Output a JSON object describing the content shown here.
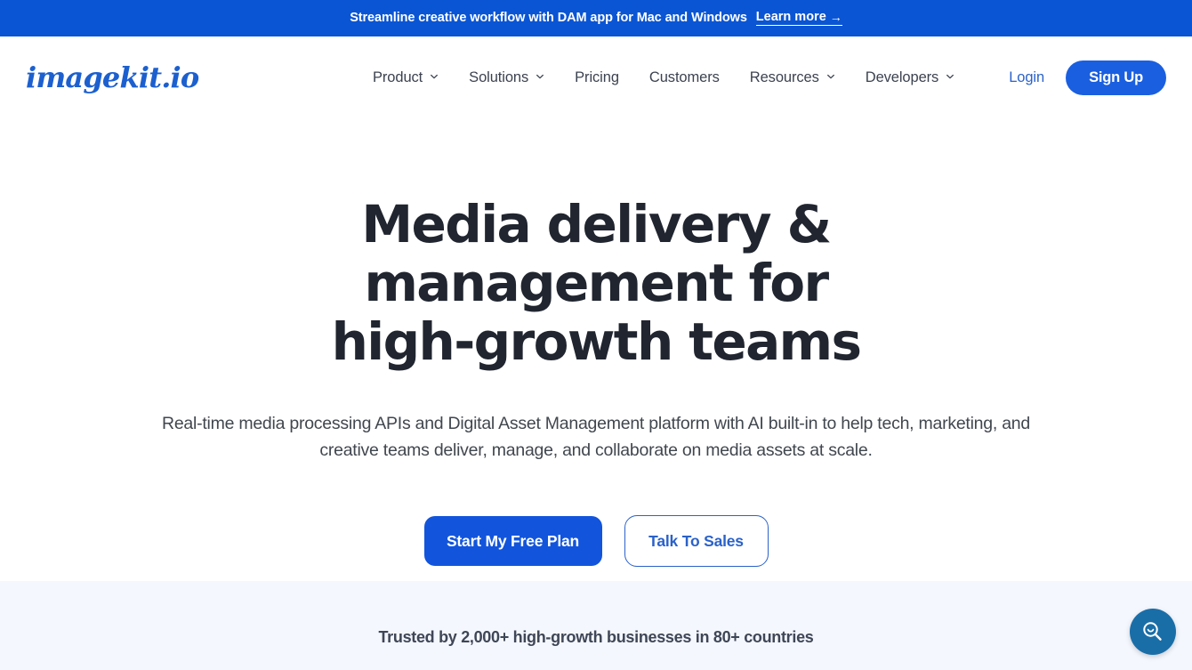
{
  "announcement": {
    "text": "Streamline creative workflow with DAM app for Mac and Windows",
    "link_label": "Learn more",
    "link_arrow": "→",
    "background_color": "#0a55d4"
  },
  "header": {
    "logo_text": "imagekit.io",
    "logo_color": "#1c60cf",
    "nav": [
      {
        "label": "Product",
        "has_caret": true,
        "icon": "chevron-down-icon"
      },
      {
        "label": "Solutions",
        "has_caret": true,
        "icon": "chevron-down-icon"
      },
      {
        "label": "Pricing",
        "has_caret": false
      },
      {
        "label": "Customers",
        "has_caret": false
      },
      {
        "label": "Resources",
        "has_caret": true,
        "icon": "chevron-down-icon"
      },
      {
        "label": "Developers",
        "has_caret": true,
        "icon": "chevron-down-icon"
      }
    ],
    "login_label": "Login",
    "signup_label": "Sign Up",
    "accent_color": "#1a5fe0"
  },
  "hero": {
    "title_line1": "Media delivery & management for",
    "title_line2": "high-growth teams",
    "subtitle": "Real-time media processing APIs and Digital Asset Management platform with AI built-in to help tech, marketing, and creative teams deliver, manage, and collaborate on media assets at scale.",
    "primary_cta": "Start My Free Plan",
    "secondary_cta": "Talk To Sales"
  },
  "trusted": {
    "text": "Trusted by 2,000+ high-growth businesses in 80+ countries",
    "background_color": "#f4f7fe"
  },
  "floating": {
    "search_icon": "search-icon",
    "color": "#1a6ea8"
  }
}
